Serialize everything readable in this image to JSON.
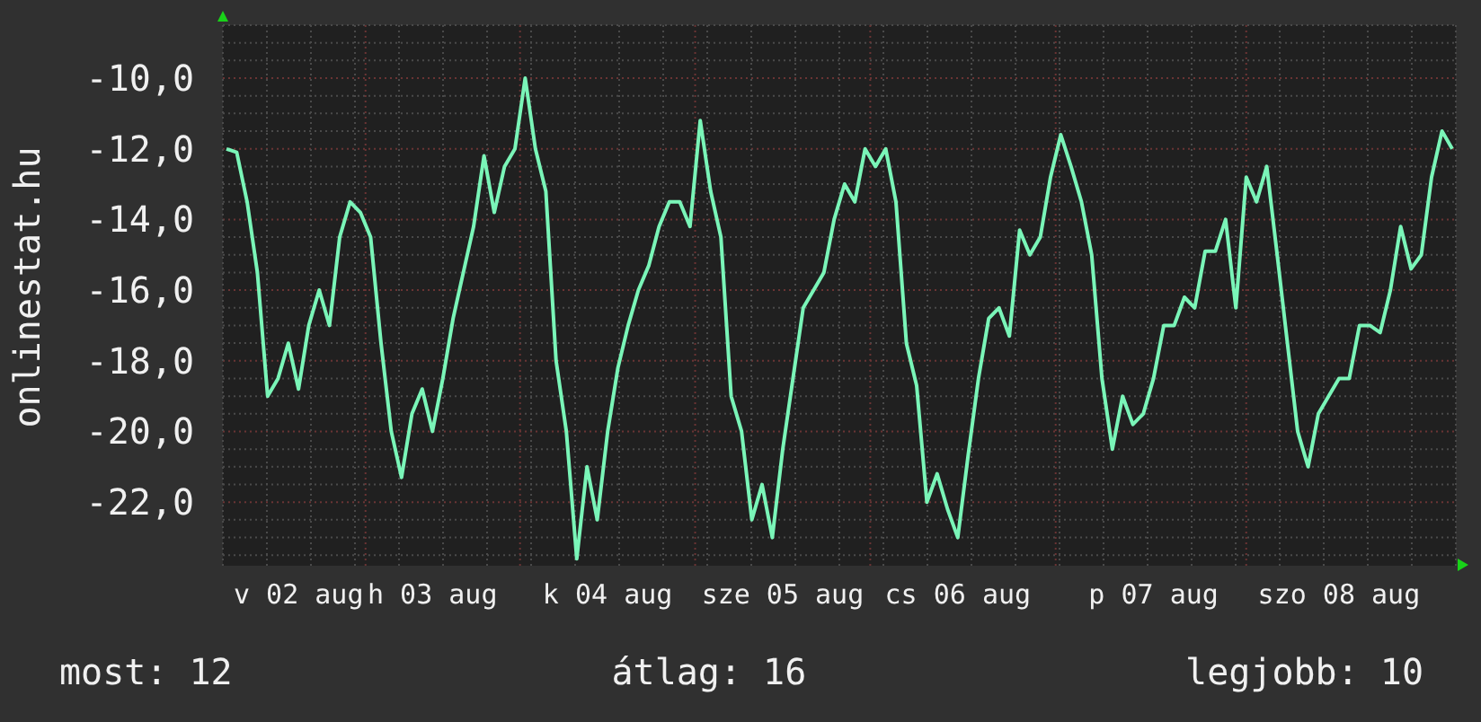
{
  "chart": {
    "chart_data": {
      "type": "line",
      "ylabel": "onlinestat.hu",
      "categories": [
        null,
        null,
        null,
        null,
        null,
        null,
        null,
        "v 02 aug",
        null,
        null,
        null,
        null,
        null,
        null,
        null,
        null,
        null,
        null,
        null,
        null,
        "h 03 aug",
        null,
        null,
        null,
        null,
        null,
        null,
        null,
        null,
        null,
        null,
        null,
        null,
        null,
        null,
        null,
        null,
        "k 04 aug",
        null,
        null,
        null,
        null,
        null,
        null,
        null,
        null,
        null,
        null,
        null,
        null,
        null,
        null,
        null,
        null,
        "sze 05 aug",
        null,
        null,
        null,
        null,
        null,
        null,
        null,
        null,
        null,
        null,
        null,
        null,
        null,
        null,
        null,
        null,
        "cs 06 aug",
        null,
        null,
        null,
        null,
        null,
        null,
        null,
        null,
        null,
        null,
        null,
        null,
        null,
        null,
        null,
        null,
        null,
        null,
        "p 07 aug",
        null,
        null,
        null,
        null,
        null,
        null,
        null,
        null,
        null,
        null,
        null,
        null,
        null,
        null,
        null,
        null,
        null,
        "szo 08 aug",
        null,
        null,
        null,
        null,
        null,
        null,
        null,
        null,
        null,
        null,
        null
      ],
      "series": [
        {
          "color": "#7af5b8",
          "values": [
            -12.0,
            -12.1,
            -13.5,
            -15.5,
            -19.0,
            -18.5,
            -17.5,
            -18.8,
            -17.0,
            -16.0,
            -17.0,
            -14.5,
            -13.5,
            -13.8,
            -14.5,
            -17.5,
            -20.0,
            -21.3,
            -19.5,
            -18.8,
            -20.0,
            -18.5,
            -16.8,
            -15.5,
            -14.2,
            -12.2,
            -13.8,
            -12.5,
            -12.0,
            -10.0,
            -12.0,
            -13.2,
            -18.0,
            -20.0,
            -23.6,
            -21.0,
            -22.5,
            -20.0,
            -18.2,
            -17.0,
            -16.0,
            -15.3,
            -14.2,
            -13.5,
            -13.5,
            -14.2,
            -11.2,
            -13.2,
            -14.5,
            -19.0,
            -20.0,
            -22.5,
            -21.5,
            -23.0,
            -20.5,
            -18.5,
            -16.5,
            -16.0,
            -15.5,
            -14.0,
            -13.0,
            -13.5,
            -12.0,
            -12.5,
            -12.0,
            -13.5,
            -17.5,
            -18.7,
            -22.0,
            -21.2,
            -22.2,
            -23.0,
            -20.7,
            -18.5,
            -16.8,
            -16.5,
            -17.3,
            -14.3,
            -15.0,
            -14.5,
            -12.8,
            -11.6,
            -12.5,
            -13.5,
            -15.0,
            -18.5,
            -20.5,
            -19.0,
            -19.8,
            -19.5,
            -18.5,
            -17.0,
            -17.0,
            -16.2,
            -16.5,
            -14.9,
            -14.9,
            -14.0,
            -16.5,
            -12.8,
            -13.5,
            -12.5,
            -15.0,
            -17.5,
            -20.0,
            -21.0,
            -19.5,
            -19.0,
            -18.5,
            -18.5,
            -17.0,
            -17.0,
            -17.2,
            -16.0,
            -14.2,
            -15.4,
            -15.0,
            -12.8,
            -11.5,
            -12.0
          ]
        }
      ],
      "grid": true,
      "ylim": [
        -23.8,
        -8.5
      ],
      "yticks": [
        {
          "value": -10,
          "label": "-10,0"
        },
        {
          "value": -12,
          "label": "-12,0"
        },
        {
          "value": -14,
          "label": "-14,0"
        },
        {
          "value": -16,
          "label": "-16,0"
        },
        {
          "value": -18,
          "label": "-18,0"
        },
        {
          "value": -20,
          "label": "-20,0"
        },
        {
          "value": -22,
          "label": "-22,0"
        }
      ]
    }
  },
  "footer": [
    "most: 12",
    "átlag: 16",
    "legjobb: 10"
  ]
}
